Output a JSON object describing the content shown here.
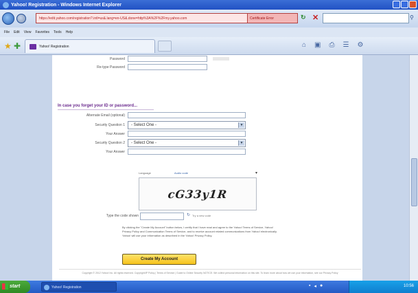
{
  "window": {
    "title": "Yahoo! Registration - Windows Internet Explorer"
  },
  "address": {
    "url": "https://edit.yahoo.com/registration?.intl=us&.lang=en-US&.done=http%3A%2F%2Fmy.yahoo.com",
    "cert_error": "Certificate Error"
  },
  "menu": [
    "File",
    "Edit",
    "View",
    "Favorites",
    "Tools",
    "Help"
  ],
  "tab": {
    "label": "Yahoo! Registration"
  },
  "form": {
    "password_label": "Password",
    "retype_label": "Re-type Password",
    "section_title": "In case you forget your ID or password...",
    "alt_email_label": "Alternate Email (optional)",
    "sq1_label": "Security Question 1",
    "sq1_value": "- Select One -",
    "answer1_label": "Your Answer",
    "sq2_label": "Security Question 2",
    "sq2_value": "- Select One -",
    "answer2_label": "Your Answer",
    "captcha_lang": "Language",
    "captcha_audio": "Audio code",
    "captcha_text": "cG33y1R",
    "captcha_input_label": "Type the code shown",
    "try_new": "Try a new code",
    "terms_text": "By clicking the \"Create My Account\" button below, I certify that I have read and agree to the Yahoo! Terms of Service, Yahoo! Privacy Policy and Communication Terms of Service, and to receive account related communications from Yahoo! electronically. Yahoo! will use your information as described in the Yahoo! Privacy Policy.",
    "create_button": "Create My Account",
    "footer": "Copyright © 2012 Yahoo! Inc. All rights reserved. Copyright/IP Policy | Terms of Service | Guide to Online Security NOTICE: We collect personal information on this site. To learn more about how we use your information, see our Privacy Policy"
  },
  "taskbar": {
    "start": "start",
    "window_item": "Yahoo! Registration",
    "clock": "10:56"
  }
}
